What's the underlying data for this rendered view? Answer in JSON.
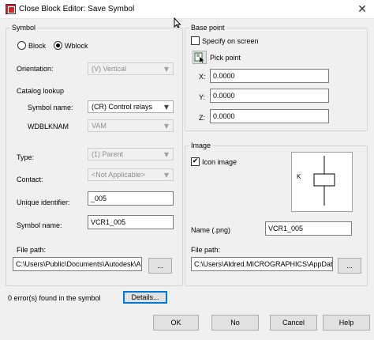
{
  "window": {
    "title": "Close Block Editor: Save Symbol",
    "close_glyph": "✕"
  },
  "symbol_group": {
    "legend": "Symbol",
    "radio_block": "Block",
    "radio_wblock": "Wblock",
    "selected": "Wblock",
    "orientation_label": "Orientation:",
    "orientation_value": "(V) Vertical",
    "catalog_lookup_label": "Catalog lookup",
    "symbol_name_label": "Symbol name:",
    "symbol_name_value": "(CR) Control relays",
    "wdblknam_label": "WDBLKNAM",
    "wdblknam_value": "VAM",
    "type_label": "Type:",
    "type_value": "(1) Parent",
    "contact_label": "Contact:",
    "contact_value": "<Not Applicable>",
    "unique_identifier_label": "Unique identifier:",
    "unique_identifier_value": "_005",
    "symbol_name2_label": "Symbol name:",
    "symbol_name2_value": "VCR1_005",
    "file_path_label": "File path:",
    "file_path_value": "C:\\Users\\Public\\Documents\\Autodesk\\Ac",
    "browse_label": "..."
  },
  "base_point_group": {
    "legend": "Base point",
    "specify_on_screen": "Specify on screen",
    "specify_checked": false,
    "pick_point": "Pick point",
    "x_label": "X:",
    "x_value": "0.0000",
    "y_label": "Y:",
    "y_value": "0.0000",
    "z_label": "Z:",
    "z_value": "0.0000"
  },
  "image_group": {
    "legend": "Image",
    "icon_image_label": "Icon image",
    "icon_image_checked": true,
    "preview_letter": "K",
    "name_label": "Name (.png)",
    "name_value": "VCR1_005",
    "file_path_label": "File path:",
    "file_path_value": "C:\\Users\\Aldred.MICROGRAPHICS\\AppData\\",
    "browse_label": "..."
  },
  "footer": {
    "error_text": "0 error(s) found in the symbol",
    "details_label": "Details...",
    "ok_label": "OK",
    "no_label": "No",
    "cancel_label": "Cancel",
    "help_label": "Help"
  },
  "icons": {
    "dropdown": "chevron-down-icon",
    "pick": "pick-point-icon",
    "check": "✔",
    "cursor": "mouse-cursor-icon"
  },
  "colors": {
    "accent": "#0078d7",
    "window_bg": "#f0f0f0",
    "disabled_text": "#8d8d8d"
  }
}
